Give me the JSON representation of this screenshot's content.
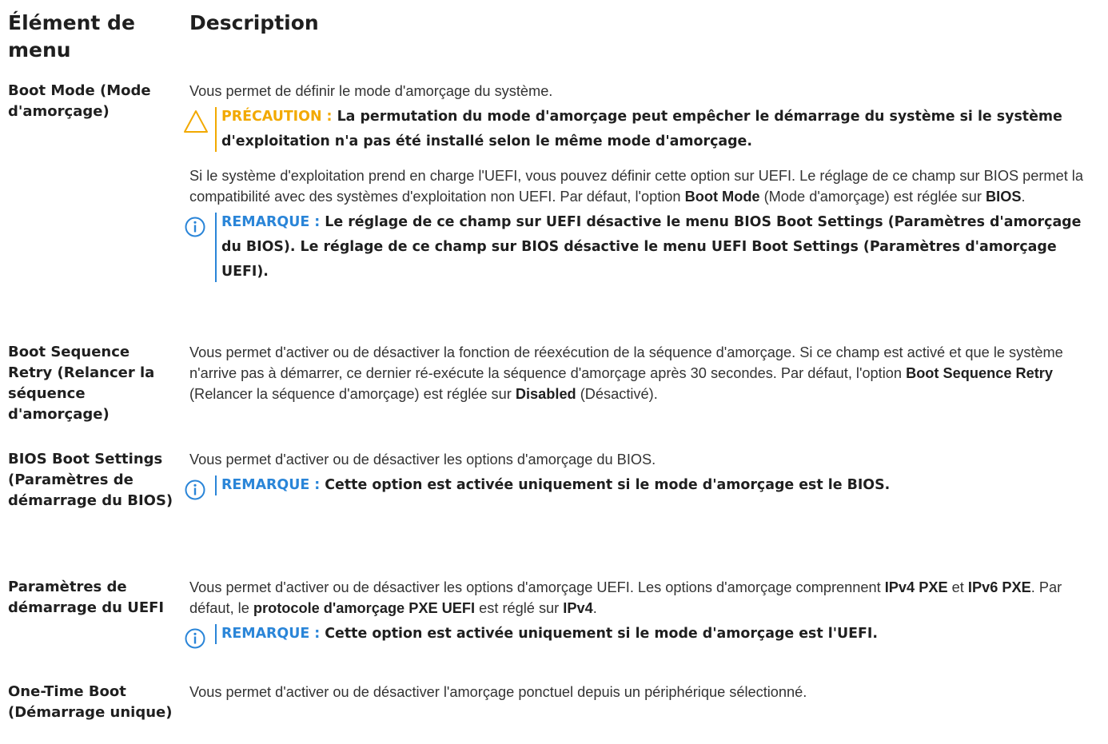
{
  "header": {
    "col1": "Élément de menu",
    "col2": "Description"
  },
  "rows": [
    {
      "label": "Boot Mode (Mode d'amorçage)",
      "intro": "Vous permet de définir le mode d'amorçage du système.",
      "caution": {
        "keyword": "PRÉCAUTION :",
        "text": "La permutation du mode d'amorçage peut empêcher le démarrage du système si le système d'exploitation n'a pas été installé selon le même mode d'amorçage."
      },
      "body": {
        "t1": "Si le système d'exploitation prend en charge l'UEFI, vous pouvez définir cette option sur UEFI. Le réglage de ce champ sur BIOS permet la compatibilité avec des systèmes d'exploitation non UEFI. Par défaut, l'option ",
        "b1": "Boot Mode",
        "t2": " (Mode d'amorçage) est réglée sur ",
        "b2": "BIOS",
        "t3": "."
      },
      "note": {
        "keyword": "REMARQUE :",
        "text": "Le réglage de ce champ sur UEFI désactive le menu BIOS Boot Settings (Paramètres d'amorçage du BIOS). Le réglage de ce champ sur BIOS désactive le menu UEFI Boot Settings (Paramètres d'amorçage UEFI)."
      }
    },
    {
      "label": "Boot Sequence Retry (Relancer la séquence d'amorçage)",
      "body": {
        "t1": "Vous permet d'activer ou de désactiver la fonction de réexécution de la séquence d'amorçage. Si ce champ est activé et que le système n'arrive pas à démarrer, ce dernier ré-exécute la séquence d'amorçage après 30 secondes. Par défaut, l'option ",
        "b1": "Boot Sequence Retry",
        "t2": " (Relancer la séquence d'amorçage) est réglée sur ",
        "b2": "Disabled",
        "t3": " (Désactivé)."
      }
    },
    {
      "label": "BIOS Boot Settings (Paramètres de démarrage du BIOS)",
      "intro": "Vous permet d'activer ou de désactiver les options d'amorçage du BIOS.",
      "note": {
        "keyword": "REMARQUE :",
        "text": "Cette option est activée uniquement si le mode d'amorçage est le BIOS."
      }
    },
    {
      "label": "Paramètres de démarrage du UEFI",
      "body": {
        "t1": "Vous permet d'activer ou de désactiver les options d'amorçage UEFI. Les options d'amorçage comprennent ",
        "b1": "IPv4 PXE",
        "t2": " et ",
        "b2": "IPv6 PXE",
        "t3": ". Par défaut, le ",
        "b3": "protocole d'amorçage PXE UEFI",
        "t4": " est réglé sur ",
        "b4": "IPv4",
        "t5": "."
      },
      "note": {
        "keyword": "REMARQUE :",
        "text": "Cette option est activée uniquement si le mode d'amorçage est l'UEFI."
      }
    },
    {
      "label": "One-Time Boot (Démarrage unique)",
      "intro": "Vous permet d'activer ou de désactiver l'amorçage ponctuel depuis un périphérique sélectionné."
    }
  ],
  "icons": {
    "caution": "caution-triangle-icon",
    "note": "info-circle-icon"
  },
  "colors": {
    "note_accent": "#2a85d8",
    "caution_accent": "#f2a900",
    "text": "#333333"
  }
}
